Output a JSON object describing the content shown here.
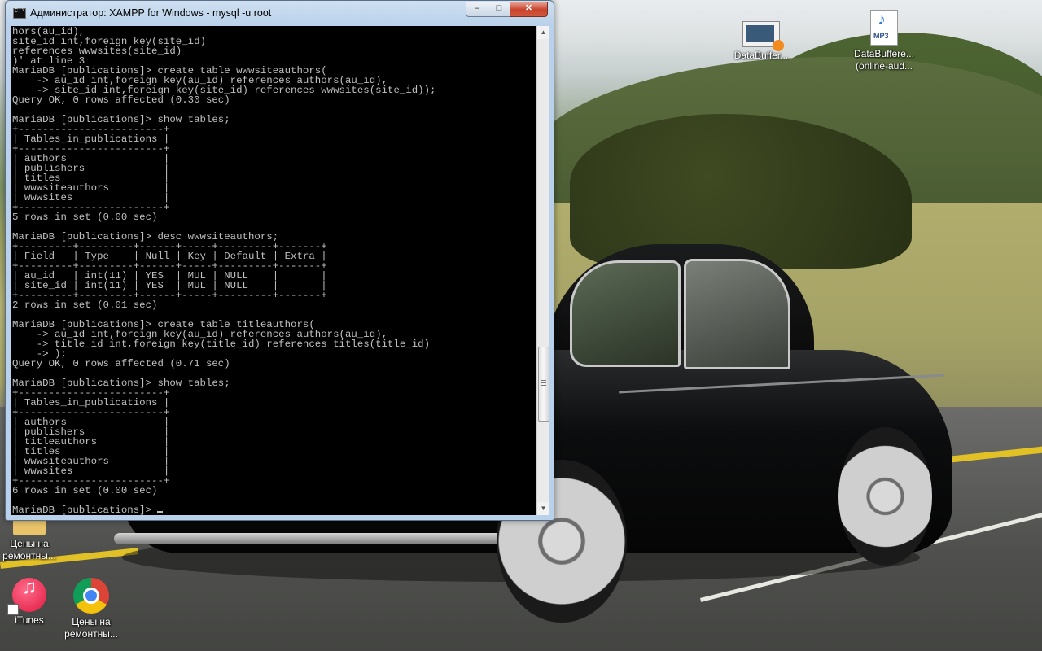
{
  "window": {
    "title": "Администратор:  XAMPP for Windows - mysql  -u root",
    "minimize_glyph": "–",
    "maximize_glyph": "□",
    "close_glyph": "✕"
  },
  "console": {
    "lines": [
      "hors(au_id),",
      "site_id int,foreign key(site_id)",
      "references wwwsites(site_id)",
      ")' at line 3",
      "MariaDB [publications]> create table wwwsiteauthors(",
      "    -> au_id int,foreign key(au_id) references authors(au_id),",
      "    -> site_id int,foreign key(site_id) references wwwsites(site_id));",
      "Query OK, 0 rows affected (0.30 sec)",
      "",
      "MariaDB [publications]> show tables;",
      "+------------------------+",
      "| Tables_in_publications |",
      "+------------------------+",
      "| authors                |",
      "| publishers             |",
      "| titles                 |",
      "| wwwsiteauthors         |",
      "| wwwsites               |",
      "+------------------------+",
      "5 rows in set (0.00 sec)",
      "",
      "MariaDB [publications]> desc wwwsiteauthors;",
      "+---------+---------+------+-----+---------+-------+",
      "| Field   | Type    | Null | Key | Default | Extra |",
      "+---------+---------+------+-----+---------+-------+",
      "| au_id   | int(11) | YES  | MUL | NULL    |       |",
      "| site_id | int(11) | YES  | MUL | NULL    |       |",
      "+---------+---------+------+-----+---------+-------+",
      "2 rows in set (0.01 sec)",
      "",
      "MariaDB [publications]> create table titleauthors(",
      "    -> au_id int,foreign key(au_id) references authors(au_id),",
      "    -> title_id int,foreign key(title_id) references titles(title_id)",
      "    -> );",
      "Query OK, 0 rows affected (0.71 sec)",
      "",
      "MariaDB [publications]> show tables;",
      "+------------------------+",
      "| Tables_in_publications |",
      "+------------------------+",
      "| authors                |",
      "| publishers             |",
      "| titleauthors           |",
      "| titles                 |",
      "| wwwsiteauthors         |",
      "| wwwsites               |",
      "+------------------------+",
      "6 rows in set (0.00 sec)",
      ""
    ],
    "prompt": "MariaDB [publications]> "
  },
  "desktop": {
    "icons": [
      {
        "label": "DataBuffer...",
        "icon": "video-file-icon"
      },
      {
        "label": "DataBuffere... (online-aud...",
        "icon": "mp3-file-icon",
        "badge": "MP3"
      },
      {
        "label": "Цены на ремонтны...",
        "icon": "folder-icon"
      },
      {
        "label": "iTunes",
        "icon": "itunes-icon"
      },
      {
        "label": "Цены на ремонтны...",
        "icon": "chrome-icon"
      }
    ]
  }
}
